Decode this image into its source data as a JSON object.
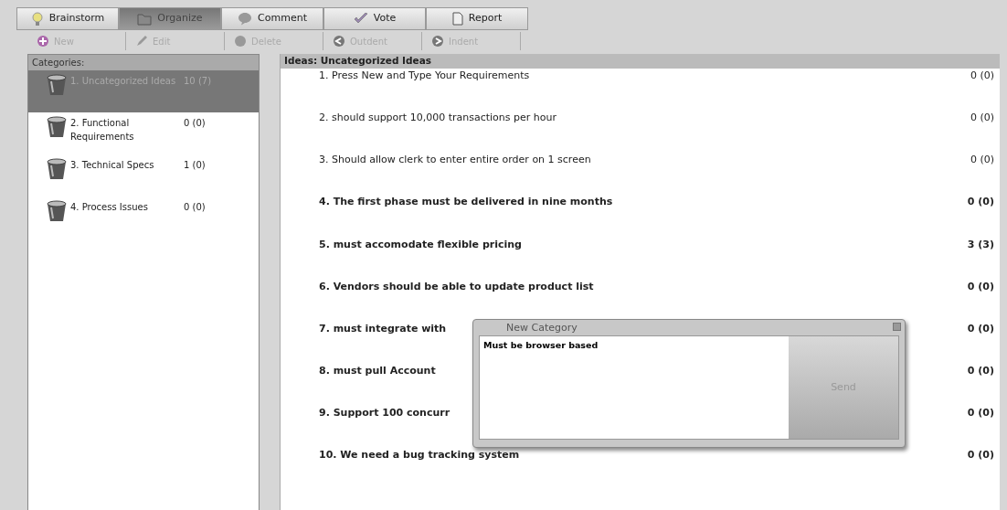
{
  "tabs": [
    {
      "label": "Brainstorm",
      "selected": false
    },
    {
      "label": "Organize",
      "selected": true
    },
    {
      "label": "Comment",
      "selected": false
    },
    {
      "label": "Vote",
      "selected": false
    },
    {
      "label": "Report",
      "selected": false
    }
  ],
  "toolbar": [
    {
      "label": "New",
      "disabled": true
    },
    {
      "label": "Edit",
      "disabled": true
    },
    {
      "label": "Delete",
      "disabled": true
    },
    {
      "label": "Outdent",
      "disabled": true
    },
    {
      "label": "Indent",
      "disabled": true
    }
  ],
  "categories": {
    "title": "Categories:",
    "items": [
      {
        "label": "1. Uncategorized Ideas",
        "count": "10 (7)",
        "selected": true
      },
      {
        "label": "2. Functional Requirements",
        "count": "0 (0)",
        "selected": false
      },
      {
        "label": "3. Technical Specs",
        "count": "1 (0)",
        "selected": false
      },
      {
        "label": "4. Process Issues",
        "count": "0 (0)",
        "selected": false
      }
    ]
  },
  "ideas": {
    "title": "Ideas: Uncategorized Ideas",
    "rows": [
      {
        "text": "1. Press New and Type Your Requirements",
        "count": "0 (0)",
        "bold": false
      },
      {
        "text": "2. should support 10,000 transactions per hour",
        "count": "0 (0)",
        "bold": false
      },
      {
        "text": "3. Should allow clerk to enter entire order on 1 screen",
        "count": "0 (0)",
        "bold": false
      },
      {
        "text": "4. The first phase must be delivered in nine months",
        "count": "0 (0)",
        "bold": true
      },
      {
        "text": "5. must accomodate flexible pricing",
        "count": "3 (3)",
        "bold": true
      },
      {
        "text": "6. Vendors should be able to update product list",
        "count": "0 (0)",
        "bold": true
      },
      {
        "text": "7. must integrate with",
        "count": "0 (0)",
        "bold": true
      },
      {
        "text": "8. must pull Account",
        "count": "0 (0)",
        "bold": true
      },
      {
        "text": "9. Support 100 concurr",
        "count": "0 (0)",
        "bold": true
      },
      {
        "text": "10. We need a bug tracking system",
        "count": "0 (0)",
        "bold": true
      }
    ]
  },
  "dialog": {
    "title": "New Category",
    "value": "Must be browser based",
    "button": "Send",
    "button_disabled": true
  }
}
